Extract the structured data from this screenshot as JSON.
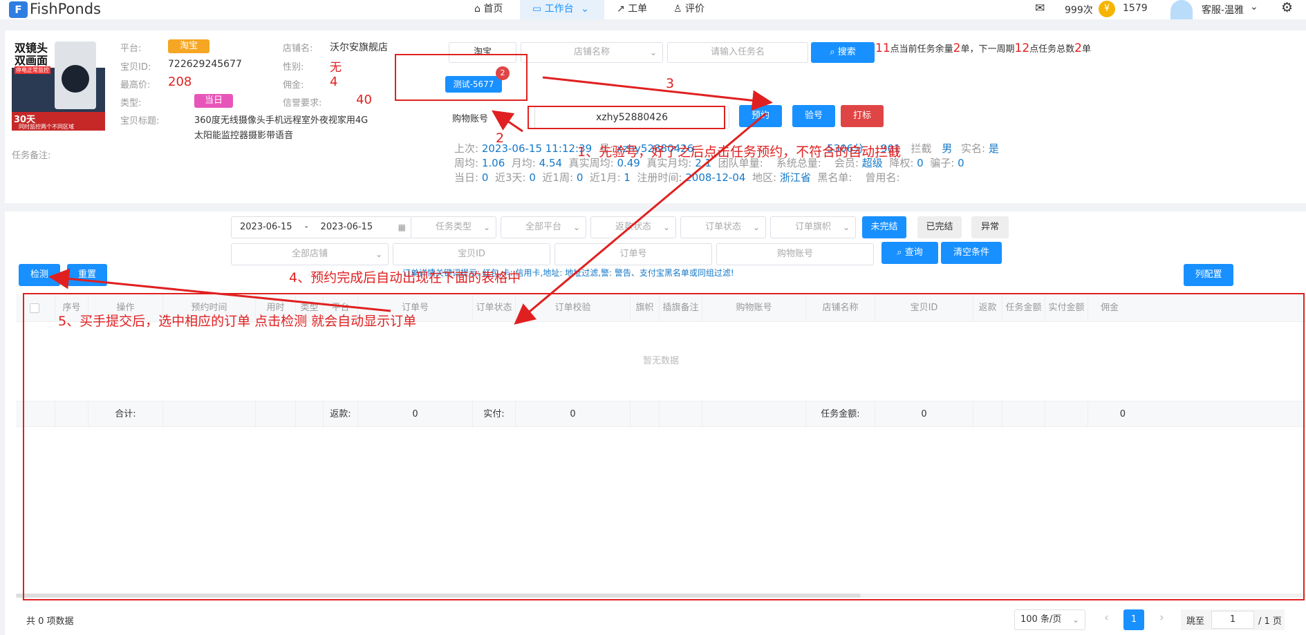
{
  "header": {
    "logo_icon": "fishponds-logo-icon",
    "logo_text": "FishPonds",
    "nav": [
      {
        "icon": "home-icon",
        "label": "首页"
      },
      {
        "icon": "monitor-icon",
        "label": "工作台"
      },
      {
        "icon": "external-link-icon",
        "label": "工单"
      },
      {
        "icon": "user-icon",
        "label": "评价"
      }
    ],
    "mail_icon": "mail-icon",
    "message_count": "999次",
    "coin_symbol": "¥",
    "coin_amount": "1579",
    "username": "客服-温雅",
    "settings_icon": "gear-icon"
  },
  "task": {
    "thumb": {
      "line1": "双镜头",
      "line2": "双画面",
      "line3": "停电正常监控",
      "days": "30天",
      "bottom": "同时监控两个不同区域"
    },
    "platform_label": "平台:",
    "platform_value": "淘宝",
    "shop_label": "店铺名:",
    "shop_value": "沃尔安旗舰店",
    "item_id_label": "宝贝ID:",
    "item_id_value": "722629245677",
    "gender_label": "性别:",
    "gender_value": "无",
    "max_price_label": "最高价:",
    "max_price_value": "208",
    "commission_label": "佣金:",
    "commission_value": "4",
    "type_label": "类型:",
    "type_value": "当日",
    "credit_label": "信誉要求:",
    "credit_value": "40",
    "title_label": "宝贝标题:",
    "title_line1": "360度无线摄像头手机远程室外夜视家用4G",
    "title_line2": "太阳能监控器摄影带语音",
    "note_label": "任务备注:"
  },
  "task_controls": {
    "platform_select": "淘宝",
    "shop_placeholder": "店铺名称",
    "task_placeholder": "请输入任务名",
    "search_label": "搜索",
    "summary": {
      "a": "11",
      "b": "点当前任务余量",
      "c": "2",
      "d": "单，下一周期",
      "e": "12",
      "f": "点任务总数",
      "g": "2",
      "h": "单"
    },
    "task_chip": "测试-5677",
    "task_chip_badge": "2",
    "account_label": "购物账号",
    "account_value": "xzhy52880426",
    "reserve_label": "预约",
    "verify_label": "验号",
    "mark_label": "打标"
  },
  "account_info": {
    "line1": [
      {
        "k": "上次:",
        "v": "2023-06-15 11:12:39"
      },
      {
        "k": "号:",
        "v": "xzhy52880426"
      },
      {
        "k": "性别:",
        "v": "男"
      },
      {
        "k": "实名:",
        "v": "是"
      }
    ],
    "line1_mid": "5306分",
    "line1_mid2": "901",
    "line1_mid3": "拦截",
    "line2": [
      {
        "k": "周均:",
        "v": "1.06"
      },
      {
        "k": "月均:",
        "v": "4.54"
      },
      {
        "k": "真实周均:",
        "v": "0.49"
      },
      {
        "k": "真实月均:",
        "v": "2.1"
      },
      {
        "k": "团队单量:",
        "v": ""
      },
      {
        "k": "系统总量:",
        "v": ""
      },
      {
        "k": "会员:",
        "v": "超级"
      },
      {
        "k": "降权:",
        "v": "0"
      },
      {
        "k": "骗子:",
        "v": "0"
      }
    ],
    "line3": [
      {
        "k": "当日:",
        "v": "0"
      },
      {
        "k": "近3天:",
        "v": "0"
      },
      {
        "k": "近1周:",
        "v": "0"
      },
      {
        "k": "近1月:",
        "v": "1"
      },
      {
        "k": "注册时间:",
        "v": "2008-12-04"
      },
      {
        "k": "地区:",
        "v": "浙江省"
      },
      {
        "k": "黑名单:",
        "v": ""
      },
      {
        "k": "曾用名:",
        "v": ""
      }
    ]
  },
  "filters": {
    "date_start": "2023-06-15",
    "date_sep": "-",
    "date_end": "2023-06-15",
    "task_type": "任务类型",
    "all_platform": "全部平台",
    "rebate_status": "返款状态",
    "order_status": "订单状态",
    "order_flag": "订单旗帜",
    "unfinished": "未完结",
    "finished": "已完结",
    "abnormal": "异常",
    "all_shops": "全部店铺",
    "item_id": "宝贝ID",
    "order_no": "订单号",
    "buyer_account": "购物账号",
    "query": "查询",
    "clear": "清空条件",
    "detect": "检测",
    "reset": "重置",
    "col_config": "列配置",
    "hint": "订单详情关键词提示: 红包,卡: 信用卡,地址: 地址过滤,警: 警告、支付宝黑名单或同组过滤!"
  },
  "table": {
    "headers": [
      "序号",
      "操作",
      "预约时间",
      "用时",
      "类型",
      "平台",
      "订单号",
      "订单状态",
      "订单校验",
      "旗帜",
      "插旗备注",
      "购物账号",
      "店铺名称",
      "宝贝ID",
      "返款",
      "任务金额",
      "实付金额",
      "佣金"
    ],
    "empty": "暂无数据",
    "footer": {
      "total": "合计:",
      "rebate": "返款:",
      "rebate_v": "0",
      "paid": "实付:",
      "paid_v": "0",
      "task_amount": "任务金额:",
      "task_amount_v": "0",
      "commission_v": "0"
    }
  },
  "pagination": {
    "total_text": "共 0 项数据",
    "page_size": "100 条/页",
    "prev": "‹",
    "current": "1",
    "next": "›",
    "jump_label": "跳至",
    "jump_value": "1",
    "total_pages": "/ 1 页"
  },
  "annotations": {
    "a1": "1、先验号，好了之后点击任务预约，不符合的自动拦截",
    "a2": "2",
    "a3": "3",
    "a4": "4、预约完成后自动出现在下面的表格中",
    "a5": "5、买手提交后，选中相应的订单  点击检测 就会自动显示订单"
  }
}
